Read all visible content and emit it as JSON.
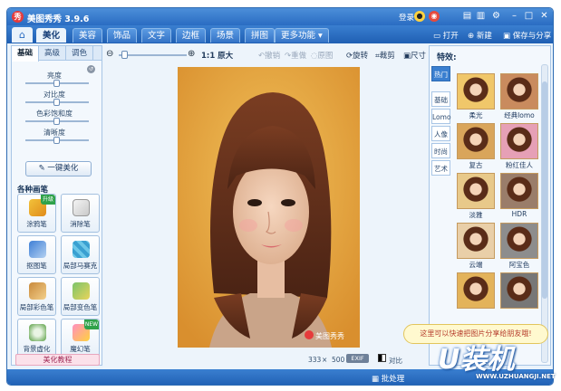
{
  "window": {
    "app_title": "美图秀秀 3.9.6",
    "login": "登录",
    "logo_text": "秀"
  },
  "menu": {
    "tabs": [
      "美化",
      "美容",
      "饰品",
      "文字",
      "边框",
      "场景",
      "拼图",
      "更多功能 ▾"
    ],
    "open": "打开",
    "new": "新建",
    "save": "保存与分享"
  },
  "left_panel": {
    "subtabs": [
      "基础",
      "高级",
      "调色"
    ],
    "sliders": [
      {
        "label": "亮度",
        "level": 0.5
      },
      {
        "label": "对比度",
        "level": 0.5
      },
      {
        "label": "色彩饱和度",
        "level": 0.5
      },
      {
        "label": "清晰度",
        "level": 0.5
      }
    ],
    "one_click": "一键美化",
    "brush_section": "各种画笔",
    "tools": [
      {
        "label": "涂鸦笔",
        "icon": "brush-icon",
        "badge": "升级"
      },
      {
        "label": "消除笔",
        "icon": "eraser-icon",
        "badge": ""
      },
      {
        "label": "抠图笔",
        "icon": "cutout-pen-icon",
        "badge": ""
      },
      {
        "label": "局部马赛克",
        "icon": "mosaic-icon",
        "badge": ""
      },
      {
        "label": "局部彩色笔",
        "icon": "color-brush-icon",
        "badge": ""
      },
      {
        "label": "局部变色笔",
        "icon": "color-change-icon",
        "badge": ""
      },
      {
        "label": "背景虚化",
        "icon": "blur-icon",
        "badge": ""
      },
      {
        "label": "魔幻笔",
        "icon": "magic-pen-icon",
        "badge": "NEW"
      }
    ],
    "tutorial": "美化教程"
  },
  "canvas": {
    "zoom_original": "1:1 原大",
    "undo": "撤销",
    "redo": "重做",
    "restore": "原图",
    "rotate": "旋转",
    "crop": "裁剪",
    "size": "尺寸",
    "photo_watermark": "美图秀秀",
    "width": "333",
    "times": "×",
    "height": "500",
    "exif": "EXIF",
    "compare": "对比"
  },
  "effects": {
    "title": "特效:",
    "categories": [
      "热门",
      "基础",
      "Lomo",
      "人像",
      "时尚",
      "艺术"
    ],
    "items": [
      "柔光",
      "经典lomo",
      "复古",
      "粉红佳人",
      "淡雅",
      "HDR",
      "云端",
      "阿宝色",
      "",
      ""
    ]
  },
  "bottom": {
    "batch": "批处理",
    "tip": "这里可以快速把图片分享给朋友哦!"
  },
  "watermark": {
    "logo": "U装机",
    "url": "WWW.UZHUANGJI.NET"
  },
  "colors": {
    "accent_blue": "#2a6cc2",
    "photo_background": "#e6a846"
  }
}
